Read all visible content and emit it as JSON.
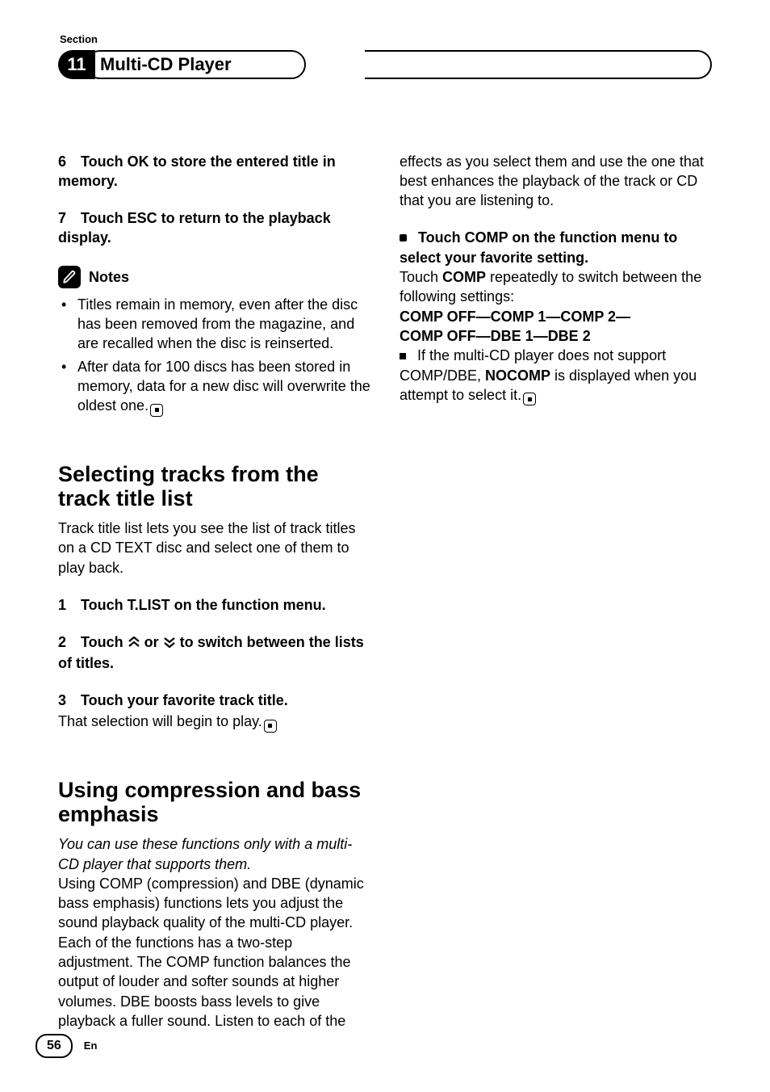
{
  "header": {
    "section_label": "Section",
    "section_number": "11",
    "title": "Multi-CD Player"
  },
  "left": {
    "step6": "Touch OK to store the entered title in memory.",
    "step7": "Touch ESC to return to the playback display.",
    "notes_label": "Notes",
    "note1": "Titles remain in memory, even after the disc has been removed from the magazine, and are recalled when the disc is reinserted.",
    "note2": "After data for 100 discs has been stored in memory, data for a new disc will overwrite the oldest one.",
    "sectA_title": "Selecting tracks from the track title list",
    "sectA_intro": "Track title list lets you see the list of track titles on a CD TEXT disc and select one of them to play back.",
    "sectA_step1": "Touch T.LIST on the function menu.",
    "sectA_step2_pre": "Touch ",
    "sectA_step2_mid": " or ",
    "sectA_step2_post": " to switch between the lists of titles.",
    "sectA_step3": "Touch your favorite track title.",
    "sectA_step3_body": "That selection will begin to play.",
    "sectB_title": "Using compression and bass emphasis",
    "sectB_italic": "You can use these functions only with a multi-CD player that supports them.",
    "sectB_body": "Using COMP (compression) and DBE (dynamic bass emphasis) functions lets you adjust the sound playback quality of the multi-CD player. Each of the functions has a two-step adjustment. The COMP function balances the output of louder and softer sounds at higher volumes. DBE boosts bass levels to give playback a fuller sound. Listen to each of the"
  },
  "right": {
    "cont": "effects as you select them and use the one that best enhances the playback of the track or CD that you are listening to.",
    "bullet_head": "Touch COMP on the function menu to select your favorite setting.",
    "bullet_body_pre": "Touch ",
    "bullet_body_comp": "COMP",
    "bullet_body_post": " repeatedly to switch between the following settings:",
    "seq1a": "COMP OFF",
    "seq1b": "COMP 1",
    "seq1c": "COMP 2",
    "seq2a": "COMP OFF",
    "seq2b": "DBE 1",
    "seq2c": "DBE 2",
    "note_line1": "If the multi-CD player does not support COMP/DBE, ",
    "note_bold": "NOCOMP",
    "note_line2": " is displayed when you attempt to select it."
  },
  "footer": {
    "page": "56",
    "lang": "En"
  }
}
